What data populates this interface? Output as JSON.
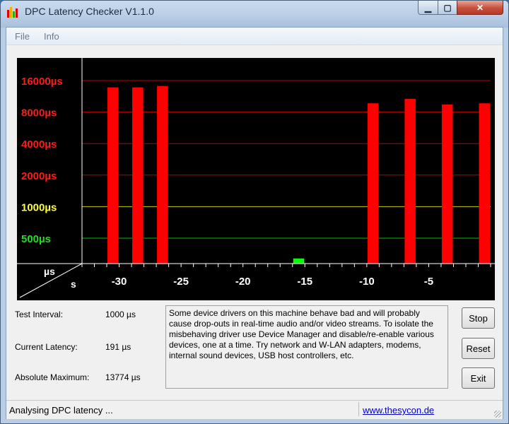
{
  "window": {
    "title": "DPC Latency Checker V1.1.0",
    "controls": {
      "minimize": "▁",
      "maximize": "▢",
      "close": "✕"
    }
  },
  "menu": {
    "items": [
      {
        "label": "File"
      },
      {
        "label": "Info"
      }
    ]
  },
  "chart_data": {
    "type": "bar",
    "y_scale": "log2",
    "y_tick_labels": [
      {
        "label": "16000µs",
        "value": 16000,
        "color": "#ff1a1a"
      },
      {
        "label": "8000µs",
        "value": 8000,
        "color": "#ff1a1a"
      },
      {
        "label": "4000µs",
        "value": 4000,
        "color": "#ff1a1a"
      },
      {
        "label": "2000µs",
        "value": 2000,
        "color": "#ff1a1a"
      },
      {
        "label": "1000µs",
        "value": 1000,
        "color": "#ffff33"
      },
      {
        "label": "500µs",
        "value": 500,
        "color": "#22dd22"
      }
    ],
    "axis_corner": {
      "y_unit": "µs",
      "x_unit": "s"
    },
    "x_tick_labels": [
      "-30",
      "-25",
      "-20",
      "-15",
      "-10",
      "-5"
    ],
    "x_tick_values": [
      -30,
      -25,
      -20,
      -15,
      -10,
      -5
    ],
    "x_range": [
      -33,
      0
    ],
    "bar_values": [
      180,
      200,
      13774,
      170,
      13774,
      190,
      14200,
      230,
      280,
      180,
      165,
      230,
      185,
      210,
      210,
      215,
      175,
      320,
      225,
      245,
      225,
      220,
      220,
      9700,
      235,
      210,
      10700,
      255,
      200,
      9450,
      205,
      250,
      9700
    ],
    "bar_colors": {
      "high": "#ff0000",
      "normal": "#00ff00"
    },
    "threshold_us": 1000,
    "grid_colors": {
      "red": "#c00000",
      "yellow": "#c8c800",
      "green": "#00c000"
    }
  },
  "stats": {
    "test_interval": {
      "label": "Test Interval:",
      "value": "1000 µs"
    },
    "current_latency": {
      "label": "Current Latency:",
      "value": "191 µs"
    },
    "absolute_maximum": {
      "label": "Absolute Maximum:",
      "value": "13774 µs"
    }
  },
  "message": "Some device drivers on this machine behave bad and will probably cause drop-outs in real-time audio and/or video streams. To isolate the misbehaving driver use Device Manager and disable/re-enable various devices, one at a time. Try network and W-LAN adapters, modems, internal sound devices, USB host controllers, etc.",
  "buttons": {
    "stop": "Stop",
    "reset": "Reset",
    "exit": "Exit"
  },
  "status": {
    "text": "Analysing DPC latency ...",
    "link": "www.thesycon.de"
  }
}
